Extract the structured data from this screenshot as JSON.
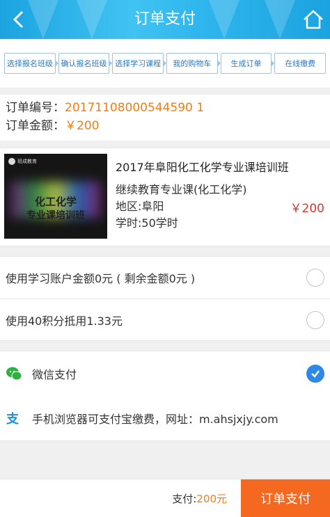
{
  "header": {
    "title": "订单支付",
    "back_icon": "chevron-left-icon",
    "home_icon": "home-icon"
  },
  "steps": [
    "选择报名班级",
    "确认报名班级",
    "选择学习课程",
    "我的购物车",
    "生成订单",
    "在线缴费"
  ],
  "order": {
    "number_label": "订单编号：",
    "number_value": "20171108000544590 1",
    "amount_label": "订单金额：",
    "amount_value": "￥200"
  },
  "product": {
    "thumb_line1": "化工化学",
    "thumb_line2": "专业课培训班",
    "thumb_logo": "班成教育",
    "title": "2017年阜阳化工化学专业课培训班",
    "category": "继续教育专业课(化工化学)",
    "region": "地区:阜阳",
    "hours": "学时:50学时",
    "price": "￥200"
  },
  "options": [
    {
      "label": "使用学习账户金额0元 ( 剩余金额0元 )",
      "checked": false
    },
    {
      "label": "使用40积分抵用1.33元",
      "checked": false
    }
  ],
  "payment": [
    {
      "label": "微信支付",
      "icon": "wechat-icon",
      "selected": true
    },
    {
      "label": "手机浏览器可支付宝缴费，网址：m.ahsjxjy.com",
      "icon": "alipay-icon",
      "selected": false
    }
  ],
  "footer": {
    "total_label": "支付:",
    "total_value": "200元",
    "submit_label": "订单支付"
  },
  "colors": {
    "header": "#1aa3e0",
    "accent_orange": "#f07d1c",
    "price_red": "#e0322b",
    "submit_bg": "#f4691f",
    "check_blue": "#2d88e6"
  }
}
